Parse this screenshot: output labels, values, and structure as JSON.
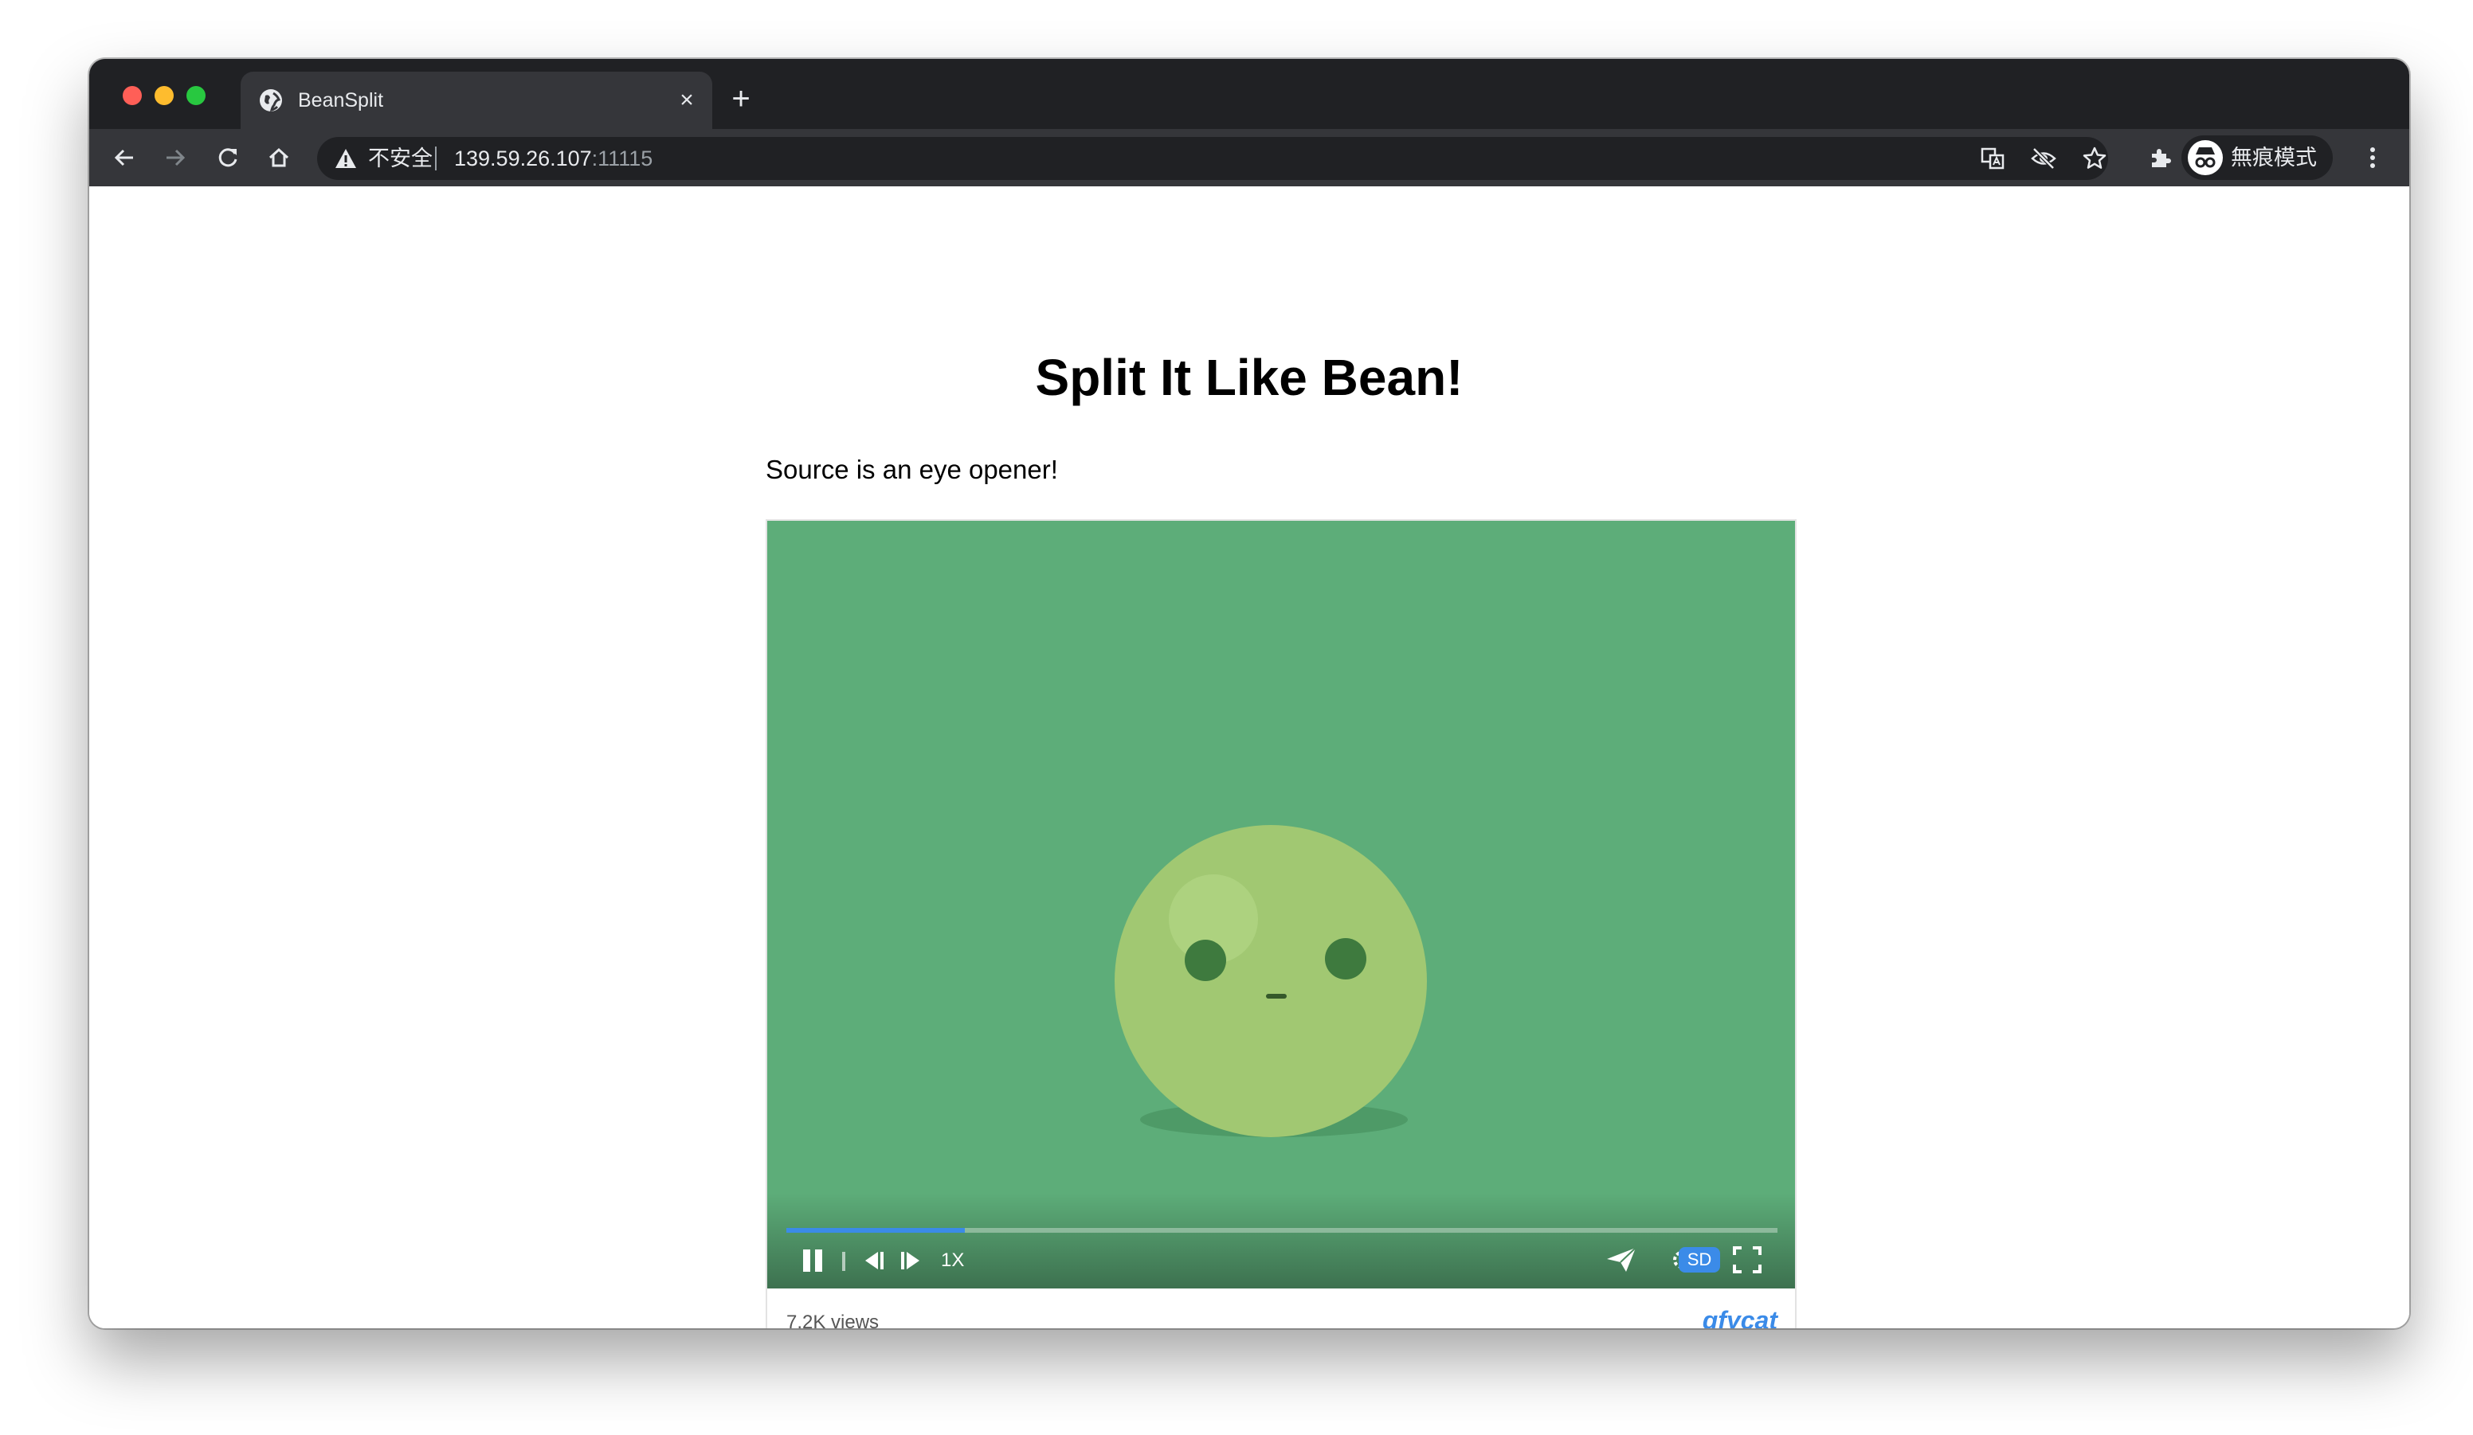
{
  "browser": {
    "tab_title": "BeanSplit",
    "tab_close": "×",
    "new_tab": "+",
    "security_label": "不安全",
    "url_host": "139.59.26.107",
    "url_port": ":11115",
    "incognito_label": "無痕模式"
  },
  "page": {
    "title": "Split It Like Bean!",
    "subtitle": "Source is an eye opener!"
  },
  "player": {
    "progress": 0.18,
    "speed_label": "1X",
    "quality_label": "SD",
    "views": "7.2K views",
    "brand": "gfycat",
    "colors": {
      "video_bg": "#5dad79",
      "bean": "#a1c872",
      "bean_eye": "#3e7a3e",
      "accent": "#3b8be8"
    }
  }
}
